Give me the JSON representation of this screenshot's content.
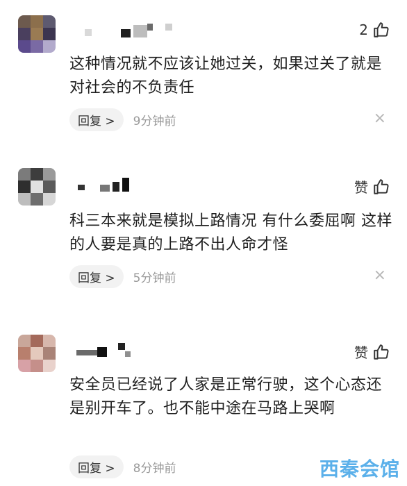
{
  "comments": [
    {
      "likes": "2",
      "text": "这种情况就不应该让她过关，如果过关了就是对社会的不负责任",
      "reply_label": "回复 >",
      "time": "9分钟前",
      "close": "×"
    },
    {
      "likes": "赞",
      "text": "科三本来就是模拟上路情况 有什么委屈啊 这样的人要是真的上路不出人命才怪",
      "reply_label": "回复 >",
      "time": "5分钟前",
      "close": "×"
    },
    {
      "likes": "赞",
      "text": "安全员已经说了人家是正常行驶，这个心态还是别开车了。也不能中途在马路上哭啊",
      "reply_label": "回复 >",
      "time": "8分钟前",
      "close": ""
    }
  ],
  "watermark": "西秦会馆",
  "icons": {
    "like": "thumbs-up-icon",
    "close": "close-icon",
    "avatar": "pixelated-avatar"
  },
  "colors": {
    "reply_bg": "#f2f2f2",
    "time": "#999999",
    "watermark": "#4aa8e8"
  }
}
